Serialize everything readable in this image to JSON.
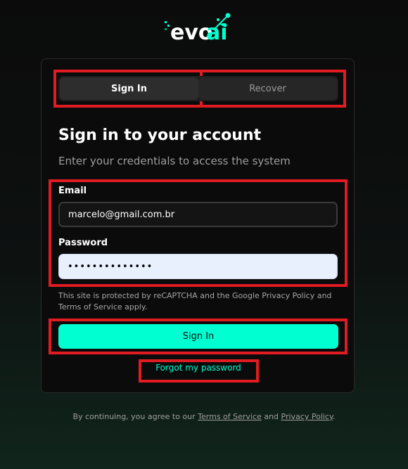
{
  "brand": {
    "logo_text_evo": "evo",
    "logo_text_ai": "ai",
    "accent_color": "#00ffd1"
  },
  "tabs": [
    {
      "label": "Sign In",
      "active": true
    },
    {
      "label": "Recover",
      "active": false
    }
  ],
  "form": {
    "title": "Sign in to your account",
    "subtitle": "Enter your credentials to access the system",
    "email_label": "Email",
    "email_value": "marcelo@gmail.com.br",
    "password_label": "Password",
    "password_value": "••••••••••••••",
    "recaptcha_notice": "This site is protected by reCAPTCHA and the Google Privacy Policy and Terms of Service apply.",
    "submit_label": "Sign In",
    "forgot_link": "Forgot my password"
  },
  "footer": {
    "prefix": "By continuing, you agree to our ",
    "terms_link": "Terms of Service",
    "middle": " and ",
    "privacy_link": "Privacy Policy",
    "suffix": "."
  }
}
